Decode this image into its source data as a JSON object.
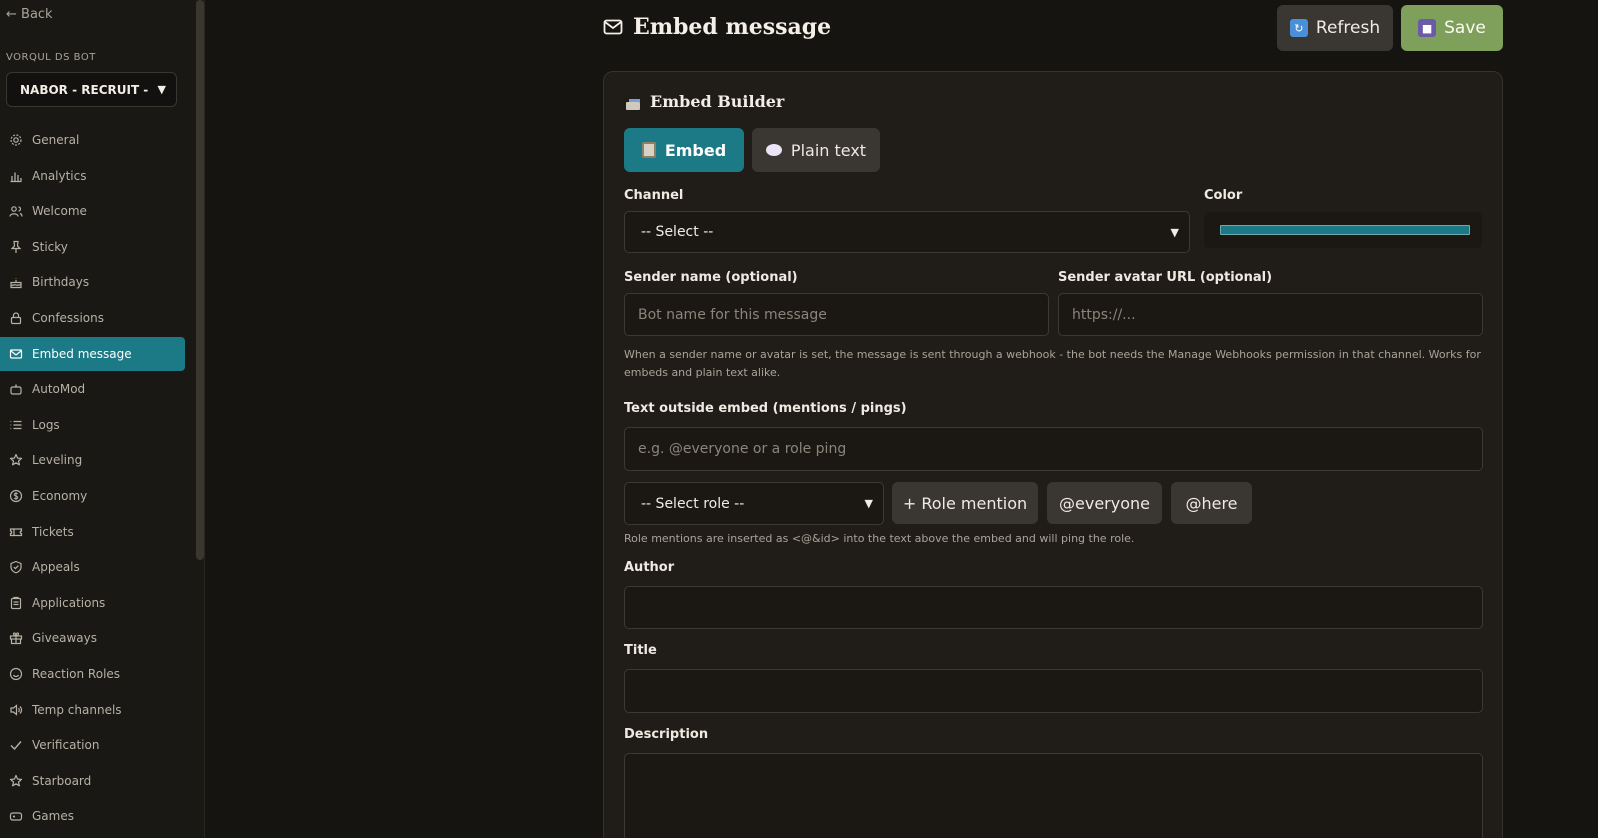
{
  "sidebar": {
    "back_label": "← Back",
    "bot_label": "VORQUL DS BOT",
    "server": "NABOR - RECRUIT - H",
    "items": [
      {
        "label": "General",
        "icon": "gear-icon"
      },
      {
        "label": "Analytics",
        "icon": "chart-icon"
      },
      {
        "label": "Welcome",
        "icon": "users-icon"
      },
      {
        "label": "Sticky",
        "icon": "pin-icon"
      },
      {
        "label": "Birthdays",
        "icon": "cake-icon"
      },
      {
        "label": "Confessions",
        "icon": "lock-icon"
      },
      {
        "label": "Embed message",
        "icon": "mail-icon",
        "active": true
      },
      {
        "label": "AutoMod",
        "icon": "bot-icon"
      },
      {
        "label": "Logs",
        "icon": "list-icon"
      },
      {
        "label": "Leveling",
        "icon": "star-icon"
      },
      {
        "label": "Economy",
        "icon": "coin-icon"
      },
      {
        "label": "Tickets",
        "icon": "ticket-icon"
      },
      {
        "label": "Appeals",
        "icon": "shield-icon"
      },
      {
        "label": "Applications",
        "icon": "clipboard-icon"
      },
      {
        "label": "Giveaways",
        "icon": "gift-icon"
      },
      {
        "label": "Reaction Roles",
        "icon": "smile-icon"
      },
      {
        "label": "Temp channels",
        "icon": "speaker-icon"
      },
      {
        "label": "Verification",
        "icon": "check-icon"
      },
      {
        "label": "Starboard",
        "icon": "star-icon"
      },
      {
        "label": "Games",
        "icon": "gamepad-icon"
      }
    ]
  },
  "header": {
    "title": "Embed message",
    "refresh_label": "Refresh",
    "save_label": "Save"
  },
  "builder": {
    "title": "Embed Builder",
    "mode_embed": "Embed",
    "mode_plain": "Plain text",
    "channel_label": "Channel",
    "channel_value": "-- Select --",
    "color_label": "Color",
    "color_value": "#1b7a86",
    "sender_name_label": "Sender name (optional)",
    "sender_name_placeholder": "Bot name for this message",
    "sender_avatar_label": "Sender avatar URL (optional)",
    "sender_avatar_placeholder": "https://...",
    "webhook_hint": "When a sender name or avatar is set, the message is sent through a webhook - the bot needs the Manage Webhooks permission in that channel. Works for embeds and plain text alike.",
    "outside_label": "Text outside embed (mentions / pings)",
    "outside_placeholder": "e.g. @everyone or a role ping",
    "role_select_value": "-- Select role --",
    "role_mention_label": "+ Role mention",
    "everyone_label": "@everyone",
    "here_label": "@here",
    "role_hint": "Role mentions are inserted as <@&id> into the text above the embed and will ping the role.",
    "author_label": "Author",
    "title_label": "Title",
    "description_label": "Description"
  },
  "colors": {
    "accent": "#1b7a86",
    "save": "#7fa05a",
    "background": "#161410"
  }
}
